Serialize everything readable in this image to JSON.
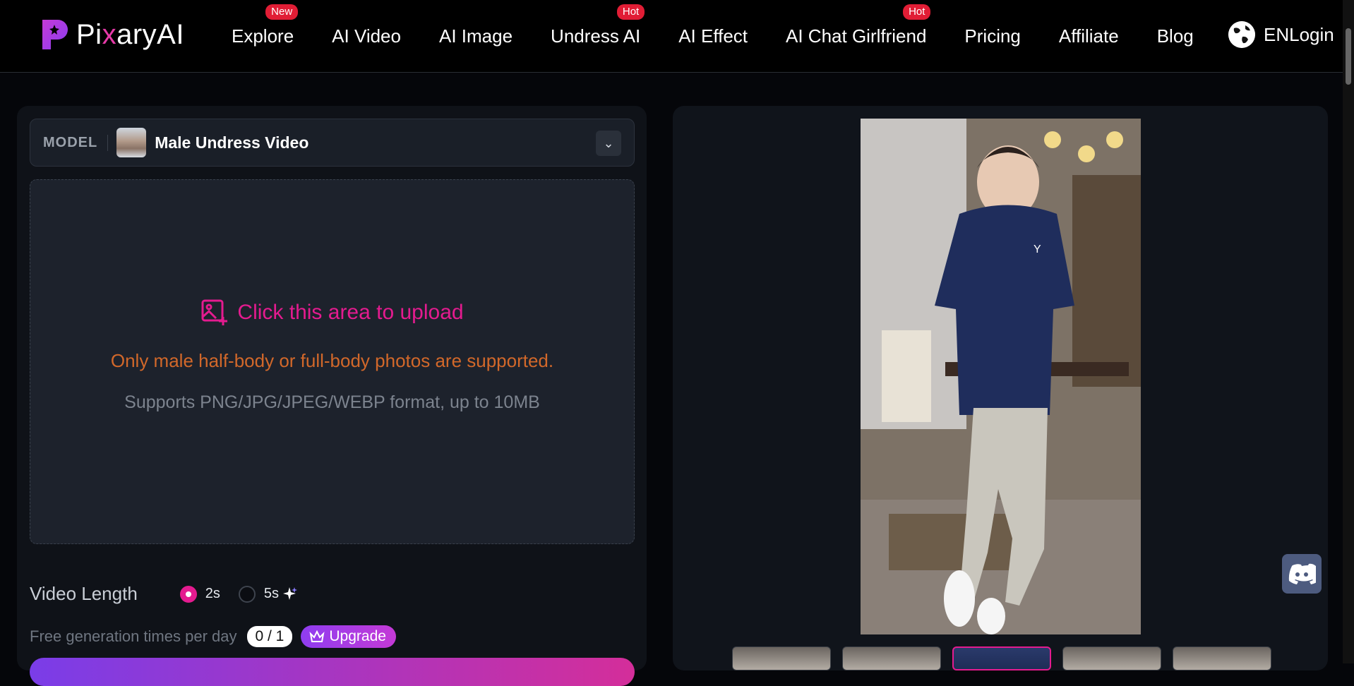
{
  "brand": {
    "name_prefix": "Pi",
    "name_mid": "x",
    "name_suffix": "aryAI",
    "accent_color": "#e63aa8"
  },
  "nav": {
    "items": [
      {
        "label": "Explore",
        "badge": "New"
      },
      {
        "label": "AI Video",
        "badge": ""
      },
      {
        "label": "AI Image",
        "badge": ""
      },
      {
        "label": "Undress AI",
        "badge": "Hot"
      },
      {
        "label": "AI Effect",
        "badge": ""
      },
      {
        "label": "AI Chat Girlfriend",
        "badge": "Hot"
      },
      {
        "label": "Pricing",
        "badge": ""
      },
      {
        "label": "Affiliate",
        "badge": ""
      },
      {
        "label": "Blog",
        "badge": ""
      }
    ],
    "language": "EN",
    "login": "Login"
  },
  "model": {
    "label": "MODEL",
    "name": "Male Undress Video"
  },
  "upload": {
    "title": "Click this area to upload",
    "note": "Only male half-body or full-body photos are supported.",
    "formats": "Supports PNG/JPG/JPEG/WEBP format, up to 10MB"
  },
  "video_length": {
    "title": "Video Length",
    "options": [
      "2s",
      "5s"
    ],
    "selected": "2s"
  },
  "free": {
    "text": "Free generation times per day",
    "count": "0 / 1",
    "upgrade": "Upgrade"
  },
  "preview": {
    "shirt_logo": "Y"
  },
  "colors": {
    "primary_pink": "#e41b8f",
    "warn_orange": "#d2682a",
    "hot_badge": "#e11d35"
  }
}
